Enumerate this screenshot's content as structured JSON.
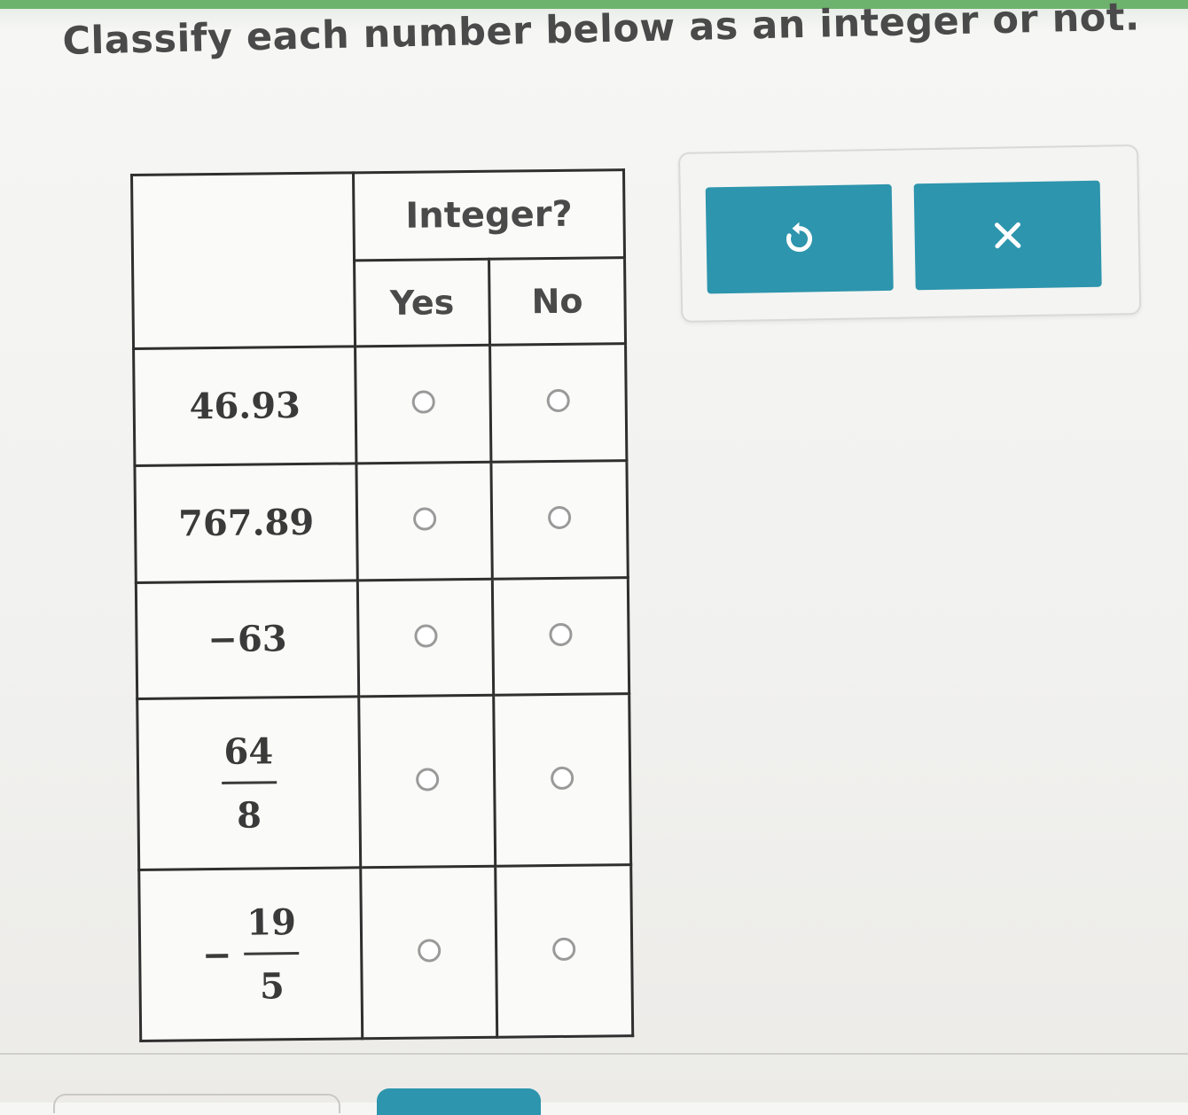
{
  "instruction": "Classify each number below as an integer or not.",
  "table": {
    "group_header": "Integer?",
    "column_headers": [
      "Yes",
      "No"
    ],
    "rows": [
      {
        "kind": "plain",
        "value": "46.93",
        "yes_selected": false,
        "no_selected": false
      },
      {
        "kind": "plain",
        "value": "767.89",
        "yes_selected": false,
        "no_selected": false
      },
      {
        "kind": "plain",
        "value": "−63",
        "yes_selected": false,
        "no_selected": false
      },
      {
        "kind": "fraction",
        "sign": "",
        "numerator": "64",
        "denominator": "8",
        "yes_selected": false,
        "no_selected": false
      },
      {
        "kind": "fraction",
        "sign": "−",
        "numerator": "19",
        "denominator": "5",
        "yes_selected": false,
        "no_selected": false
      }
    ]
  },
  "toolbar": {
    "undo_icon": "undo-icon",
    "clear_icon": "clear-x-icon"
  },
  "colors": {
    "accent": "#2d95ad",
    "top_bar": "#6db36d"
  }
}
